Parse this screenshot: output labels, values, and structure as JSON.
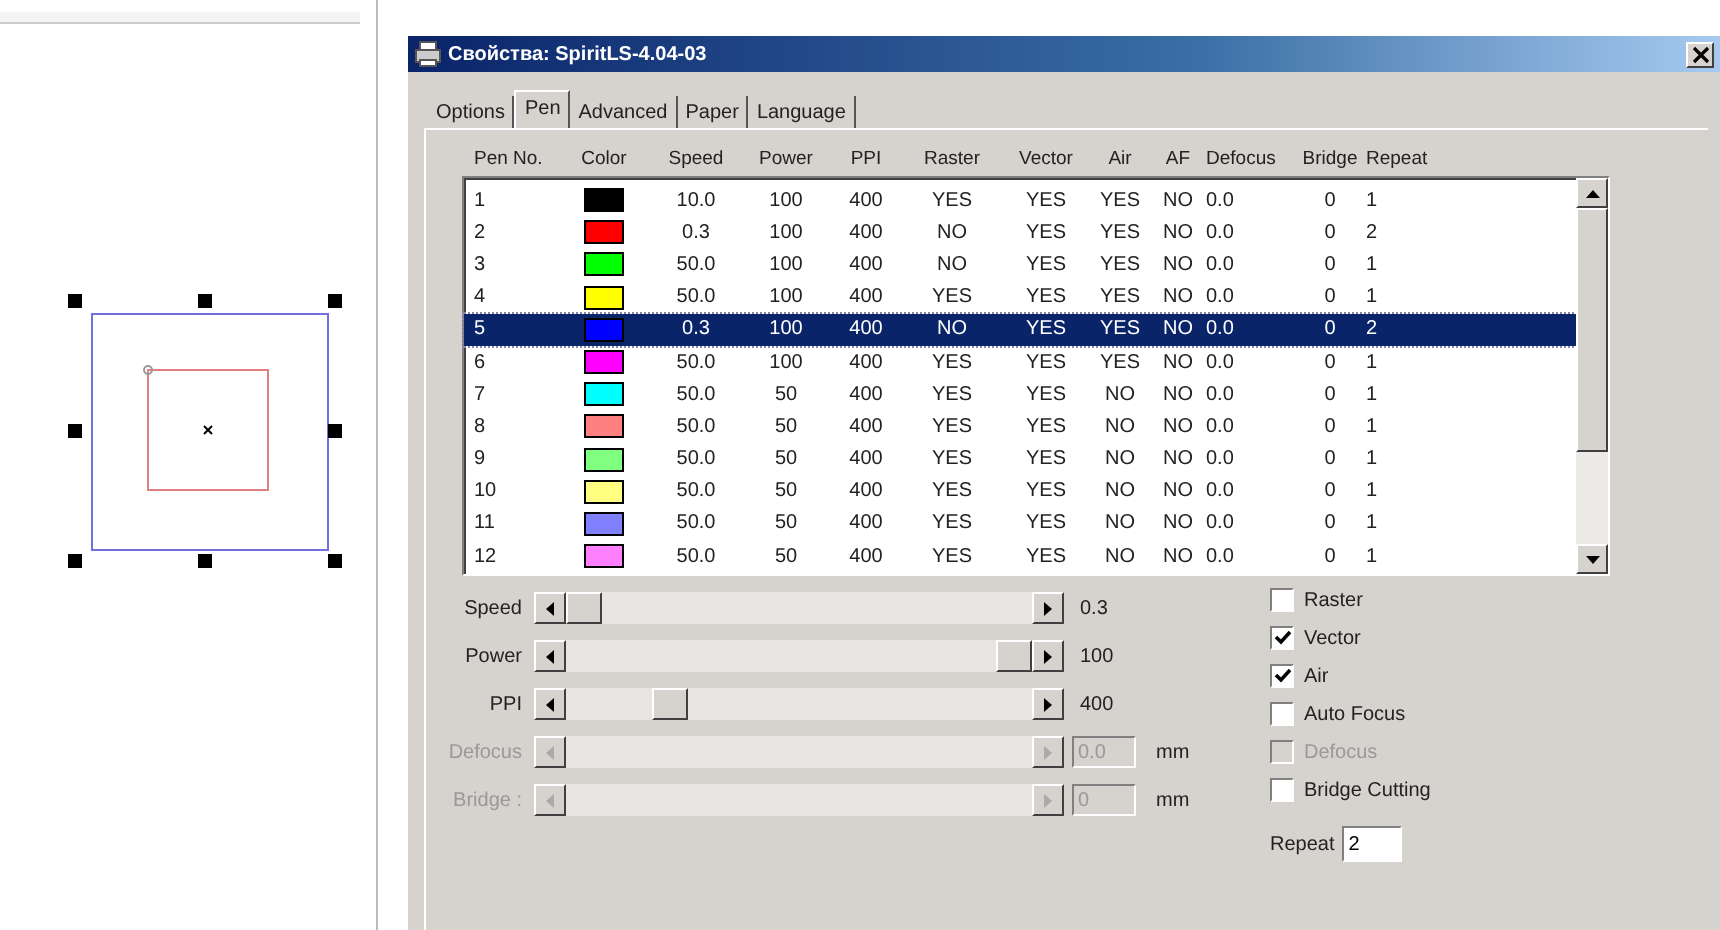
{
  "window": {
    "title": "Свойства: SpiritLS-4.04-03"
  },
  "tabs": [
    {
      "label": "Options",
      "selected": false
    },
    {
      "label": "Pen",
      "selected": true
    },
    {
      "label": "Advanced",
      "selected": false
    },
    {
      "label": "Paper",
      "selected": false
    },
    {
      "label": "Language",
      "selected": false
    }
  ],
  "table": {
    "columns": [
      "Pen No.",
      "Color",
      "Speed",
      "Power",
      "PPI",
      "Raster",
      "Vector",
      "Air",
      "AF",
      "Defocus",
      "Bridge",
      "Repeat"
    ],
    "rows": [
      {
        "pen": "1",
        "color": "#000000",
        "speed": "10.0",
        "power": "100",
        "ppi": "400",
        "raster": "YES",
        "vector": "YES",
        "air": "YES",
        "af": "NO",
        "defocus": "0.0",
        "bridge": "0",
        "repeat": "1",
        "selected": false
      },
      {
        "pen": "2",
        "color": "#ff0000",
        "speed": "0.3",
        "power": "100",
        "ppi": "400",
        "raster": "NO",
        "vector": "YES",
        "air": "YES",
        "af": "NO",
        "defocus": "0.0",
        "bridge": "0",
        "repeat": "2",
        "selected": false
      },
      {
        "pen": "3",
        "color": "#00ff00",
        "speed": "50.0",
        "power": "100",
        "ppi": "400",
        "raster": "NO",
        "vector": "YES",
        "air": "YES",
        "af": "NO",
        "defocus": "0.0",
        "bridge": "0",
        "repeat": "1",
        "selected": false
      },
      {
        "pen": "4",
        "color": "#ffff00",
        "speed": "50.0",
        "power": "100",
        "ppi": "400",
        "raster": "YES",
        "vector": "YES",
        "air": "YES",
        "af": "NO",
        "defocus": "0.0",
        "bridge": "0",
        "repeat": "1",
        "selected": false
      },
      {
        "pen": "5",
        "color": "#0000ff",
        "speed": "0.3",
        "power": "100",
        "ppi": "400",
        "raster": "NO",
        "vector": "YES",
        "air": "YES",
        "af": "NO",
        "defocus": "0.0",
        "bridge": "0",
        "repeat": "2",
        "selected": true
      },
      {
        "pen": "6",
        "color": "#ff00ff",
        "speed": "50.0",
        "power": "100",
        "ppi": "400",
        "raster": "YES",
        "vector": "YES",
        "air": "YES",
        "af": "NO",
        "defocus": "0.0",
        "bridge": "0",
        "repeat": "1",
        "selected": false
      },
      {
        "pen": "7",
        "color": "#00ffff",
        "speed": "50.0",
        "power": "50",
        "ppi": "400",
        "raster": "YES",
        "vector": "YES",
        "air": "NO",
        "af": "NO",
        "defocus": "0.0",
        "bridge": "0",
        "repeat": "1",
        "selected": false
      },
      {
        "pen": "8",
        "color": "#ff8080",
        "speed": "50.0",
        "power": "50",
        "ppi": "400",
        "raster": "YES",
        "vector": "YES",
        "air": "NO",
        "af": "NO",
        "defocus": "0.0",
        "bridge": "0",
        "repeat": "1",
        "selected": false
      },
      {
        "pen": "9",
        "color": "#80ff80",
        "speed": "50.0",
        "power": "50",
        "ppi": "400",
        "raster": "YES",
        "vector": "YES",
        "air": "NO",
        "af": "NO",
        "defocus": "0.0",
        "bridge": "0",
        "repeat": "1",
        "selected": false
      },
      {
        "pen": "10",
        "color": "#ffff80",
        "speed": "50.0",
        "power": "50",
        "ppi": "400",
        "raster": "YES",
        "vector": "YES",
        "air": "NO",
        "af": "NO",
        "defocus": "0.0",
        "bridge": "0",
        "repeat": "1",
        "selected": false
      },
      {
        "pen": "11",
        "color": "#8080ff",
        "speed": "50.0",
        "power": "50",
        "ppi": "400",
        "raster": "YES",
        "vector": "YES",
        "air": "NO",
        "af": "NO",
        "defocus": "0.0",
        "bridge": "0",
        "repeat": "1",
        "selected": false
      },
      {
        "pen": "12",
        "color": "#ff80ff",
        "speed": "50.0",
        "power": "50",
        "ppi": "400",
        "raster": "YES",
        "vector": "YES",
        "air": "NO",
        "af": "NO",
        "defocus": "0.0",
        "bridge": "0",
        "repeat": "1",
        "selected": false
      }
    ]
  },
  "sliders": [
    {
      "label": "Speed",
      "kind": "reading",
      "value": "0.3",
      "level": 0.0,
      "disabled": false
    },
    {
      "label": "Power",
      "kind": "reading",
      "value": "100",
      "level": 1.0,
      "disabled": false
    },
    {
      "label": "PPI",
      "kind": "reading",
      "value": "400",
      "level": 0.2,
      "disabled": false
    },
    {
      "label": "Defocus",
      "kind": "field",
      "value": "0.0",
      "unit": "mm",
      "disabled": true
    },
    {
      "label": "Bridge :",
      "kind": "field",
      "value": "0",
      "unit": "mm",
      "disabled": true
    }
  ],
  "checkboxes": [
    {
      "label": "Raster",
      "checked": false,
      "disabled": false
    },
    {
      "label": "Vector",
      "checked": true,
      "disabled": false
    },
    {
      "label": "Air",
      "checked": true,
      "disabled": false
    },
    {
      "label": "Auto Focus",
      "checked": false,
      "disabled": false
    },
    {
      "label": "Defocus",
      "checked": false,
      "disabled": true
    },
    {
      "label": "Bridge Cutting",
      "checked": false,
      "disabled": false
    }
  ],
  "repeat": {
    "label": "Repeat",
    "value": "2"
  }
}
